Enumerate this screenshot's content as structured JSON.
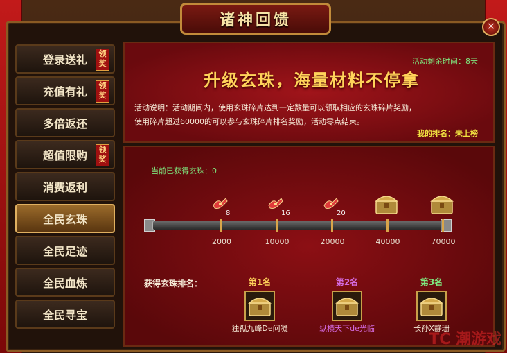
{
  "window": {
    "title": "诸神回馈",
    "close_glyph": "×"
  },
  "sidebar": {
    "items": [
      {
        "label": "登录送礼",
        "tag": "领奖"
      },
      {
        "label": "充值有礼",
        "tag": "领奖"
      },
      {
        "label": "多倍返还",
        "tag": ""
      },
      {
        "label": "超值限购",
        "tag": "领奖"
      },
      {
        "label": "消费返利",
        "tag": ""
      },
      {
        "label": "全民玄珠",
        "tag": "",
        "active": true
      },
      {
        "label": "全民足迹",
        "tag": ""
      },
      {
        "label": "全民血炼",
        "tag": ""
      },
      {
        "label": "全民寻宝",
        "tag": ""
      }
    ]
  },
  "banner": {
    "remaining_label": "活动剩余时间：8天",
    "headline": "升级玄珠，海量材料不停拿",
    "description_line1": "活动说明：活动期间内，使用玄珠碎片达到一定数量可以领取相应的玄珠碎片奖励，",
    "description_line2": "使用碎片超过60000的可以参与玄珠碎片排名奖励，活动零点结束。",
    "my_rank": "我的排名：未上榜"
  },
  "progress": {
    "current_label": "当前已获得玄珠：0",
    "current_value": 0,
    "milestones": [
      {
        "threshold": "2000",
        "reward": "gift",
        "qty": "8"
      },
      {
        "threshold": "10000",
        "reward": "gift",
        "qty": "16"
      },
      {
        "threshold": "20000",
        "reward": "gift",
        "qty": "20"
      },
      {
        "threshold": "40000",
        "reward": "chest",
        "qty": ""
      },
      {
        "threshold": "70000",
        "reward": "chest",
        "qty": ""
      }
    ]
  },
  "ranking": {
    "title": "获得玄珠排名：",
    "entries": [
      {
        "place": "第1名",
        "name": "独孤九峰De问凝",
        "place_color": "#ffd35a",
        "name_color": "#f5e9d6"
      },
      {
        "place": "第2名",
        "name": "纵横天下de光临",
        "place_color": "#d46adf",
        "name_color": "#d46adf"
      },
      {
        "place": "第3名",
        "name": "长孙X静珊",
        "place_color": "#7ee67e",
        "name_color": "#f5e9d6"
      }
    ]
  },
  "watermark": "TC 潮游戏",
  "colors": {
    "accent": "#c28b3a",
    "green": "#7ee67e",
    "gold": "#ffd35a"
  },
  "icons": {
    "close": "close-icon",
    "gift": "gift-icon",
    "chest": "treasure-chest-icon"
  }
}
